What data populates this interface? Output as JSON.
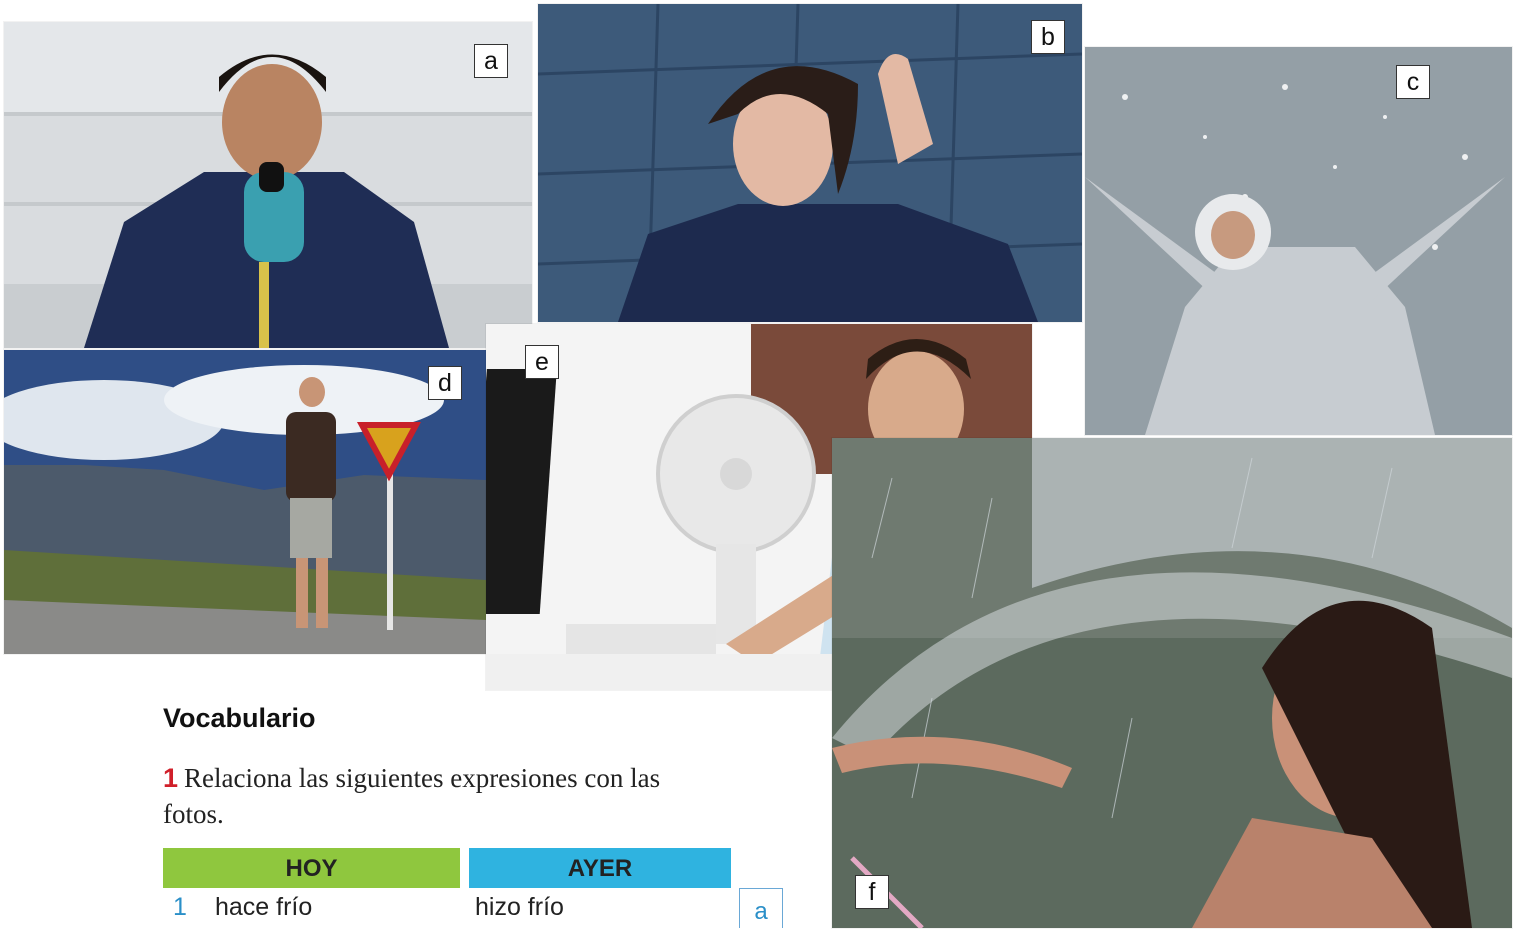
{
  "photos": [
    {
      "id": "a",
      "label": "a",
      "description_icon": "cold-man-photo"
    },
    {
      "id": "b",
      "label": "b",
      "description_icon": "windy-woman-photo"
    },
    {
      "id": "c",
      "label": "c",
      "description_icon": "snow-child-photo"
    },
    {
      "id": "d",
      "label": "d",
      "description_icon": "sunny-hiker-photo"
    },
    {
      "id": "e",
      "label": "e",
      "description_icon": "hot-man-fan-photo"
    },
    {
      "id": "f",
      "label": "f",
      "description_icon": "rain-umbrella-photo"
    }
  ],
  "vocab": {
    "heading": "Vocabulario",
    "exercise_number": "1",
    "instruction": "Relaciona las siguientes expresiones con las fotos."
  },
  "table": {
    "headers": {
      "hoy": "HOY",
      "ayer": "AYER"
    },
    "rows": [
      {
        "num": "1",
        "hoy": "hace frío",
        "ayer": "hizo frío",
        "answer": "a"
      }
    ]
  },
  "colors": {
    "hoy_header": "#8fc73e",
    "ayer_header": "#2fb3e0",
    "exercise_number": "#d01f2a"
  }
}
